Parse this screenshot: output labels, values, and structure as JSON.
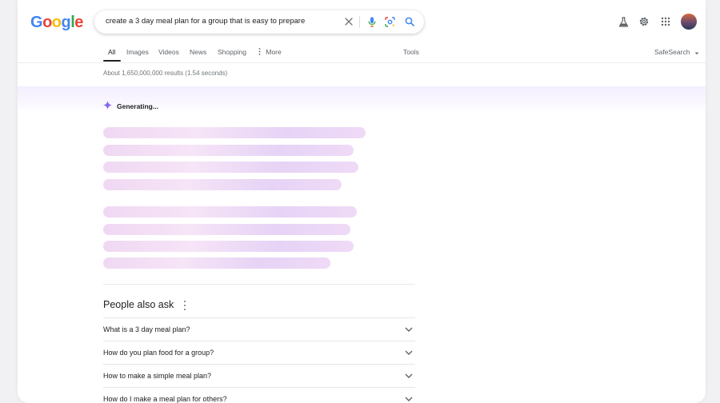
{
  "header": {
    "logo_letters": [
      {
        "char": "G",
        "color": "#4285F4"
      },
      {
        "char": "o",
        "color": "#EA4335"
      },
      {
        "char": "o",
        "color": "#FBBC05"
      },
      {
        "char": "g",
        "color": "#4285F4"
      },
      {
        "char": "l",
        "color": "#34A853"
      },
      {
        "char": "e",
        "color": "#EA4335"
      }
    ],
    "search": {
      "query": "create a 3 day meal plan for a group that is easy to prepare"
    },
    "icons": [
      "clear-icon",
      "microphone-icon",
      "lens-icon",
      "search-icon",
      "labs-flask-icon",
      "gear-icon",
      "apps-grid-icon",
      "avatar"
    ]
  },
  "tabs": {
    "items": [
      {
        "label": "All",
        "active": true
      },
      {
        "label": "Images"
      },
      {
        "label": "Videos"
      },
      {
        "label": "News"
      },
      {
        "label": "Shopping"
      },
      {
        "label": "More"
      }
    ],
    "tools": "Tools",
    "safesearch": "SafeSearch"
  },
  "results": {
    "stats": "About 1,650,000,000 results (1.54 seconds)"
  },
  "ai": {
    "status": "Generating..."
  },
  "people_also_ask": {
    "title": "People also ask",
    "questions": [
      "What is a 3 day meal plan?",
      "How do you plan food for a group?",
      "How to make a simple meal plan?",
      "How do I make a meal plan for others?"
    ]
  },
  "colors": {
    "accent": "#1a73e8",
    "text": "#202124",
    "muted": "#70757a",
    "sparkle": "#a142f4"
  }
}
